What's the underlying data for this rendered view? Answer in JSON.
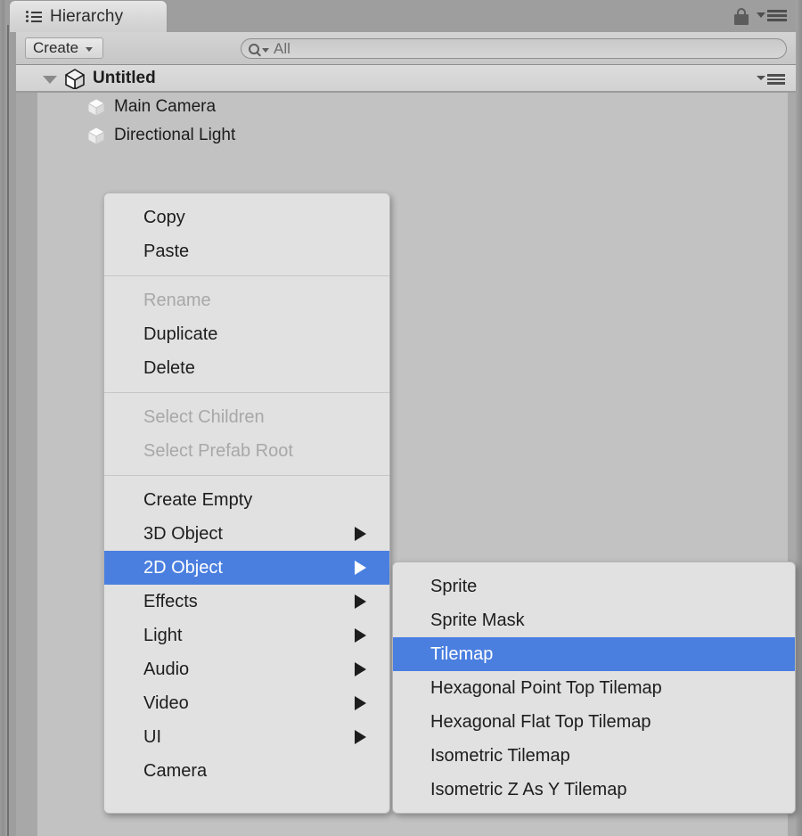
{
  "window": {
    "tab_label": "Hierarchy",
    "tab_icon": "list-icon",
    "lock_icon": "lock-icon",
    "menu_icon": "hamburger-menu-icon"
  },
  "toolbar": {
    "create_label": "Create",
    "create_caret_icon": "chevron-down-icon",
    "search_icon": "search-icon",
    "search_caret_icon": "chevron-down-icon",
    "search_placeholder": "All",
    "search_value": ""
  },
  "scene": {
    "foldout_icon": "triangle-down-icon",
    "unity_icon": "unity-logo-icon",
    "name": "Untitled",
    "menu_icon": "hamburger-menu-icon"
  },
  "hierarchy": {
    "items": [
      {
        "label": "Main Camera",
        "icon": "gameobject-cube-icon"
      },
      {
        "label": "Directional Light",
        "icon": "gameobject-cube-icon"
      }
    ]
  },
  "context_menu": {
    "groups": [
      {
        "items": [
          {
            "label": "Copy",
            "disabled": false,
            "submenu": false,
            "selected": false
          },
          {
            "label": "Paste",
            "disabled": false,
            "submenu": false,
            "selected": false
          }
        ]
      },
      {
        "items": [
          {
            "label": "Rename",
            "disabled": true,
            "submenu": false,
            "selected": false
          },
          {
            "label": "Duplicate",
            "disabled": false,
            "submenu": false,
            "selected": false
          },
          {
            "label": "Delete",
            "disabled": false,
            "submenu": false,
            "selected": false
          }
        ]
      },
      {
        "items": [
          {
            "label": "Select Children",
            "disabled": true,
            "submenu": false,
            "selected": false
          },
          {
            "label": "Select Prefab Root",
            "disabled": true,
            "submenu": false,
            "selected": false
          }
        ]
      },
      {
        "items": [
          {
            "label": "Create Empty",
            "disabled": false,
            "submenu": false,
            "selected": false
          },
          {
            "label": "3D Object",
            "disabled": false,
            "submenu": true,
            "selected": false
          },
          {
            "label": "2D Object",
            "disabled": false,
            "submenu": true,
            "selected": true
          },
          {
            "label": "Effects",
            "disabled": false,
            "submenu": true,
            "selected": false
          },
          {
            "label": "Light",
            "disabled": false,
            "submenu": true,
            "selected": false
          },
          {
            "label": "Audio",
            "disabled": false,
            "submenu": true,
            "selected": false
          },
          {
            "label": "Video",
            "disabled": false,
            "submenu": true,
            "selected": false
          },
          {
            "label": "UI",
            "disabled": false,
            "submenu": true,
            "selected": false
          },
          {
            "label": "Camera",
            "disabled": false,
            "submenu": false,
            "selected": false
          }
        ]
      }
    ]
  },
  "submenu": {
    "parent": "2D Object",
    "items": [
      {
        "label": "Sprite",
        "selected": false
      },
      {
        "label": "Sprite Mask",
        "selected": false
      },
      {
        "label": "Tilemap",
        "selected": true
      },
      {
        "label": "Hexagonal Point Top Tilemap",
        "selected": false
      },
      {
        "label": "Hexagonal Flat Top Tilemap",
        "selected": false
      },
      {
        "label": "Isometric Tilemap",
        "selected": false
      },
      {
        "label": "Isometric Z As Y Tilemap",
        "selected": false
      }
    ]
  },
  "colors": {
    "highlight": "#4a7fe0",
    "menu_bg": "#e1e1e1",
    "panel_bg": "#c2c2c2",
    "chrome_bg": "#9e9e9e",
    "disabled_text": "#a8a8a8"
  }
}
